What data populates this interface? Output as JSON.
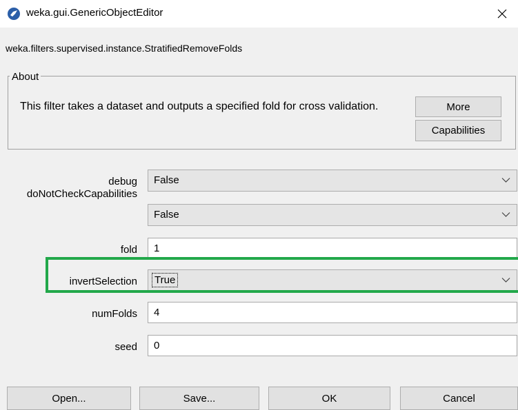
{
  "window": {
    "title": "weka.gui.GenericObjectEditor",
    "class_name": "weka.filters.supervised.instance.StratifiedRemoveFolds"
  },
  "about": {
    "legend": "About",
    "description": "This filter takes a dataset and outputs a specified fold for cross validation.",
    "more_label": "More",
    "capabilities_label": "Capabilities"
  },
  "properties": {
    "debug": {
      "label": "debug",
      "value": "False"
    },
    "doNotCheckCapabilities": {
      "label": "doNotCheckCapabilities",
      "value": "False"
    },
    "fold": {
      "label": "fold",
      "value": "1"
    },
    "invertSelection": {
      "label": "invertSelection",
      "value": "True"
    },
    "numFolds": {
      "label": "numFolds",
      "value": "4"
    },
    "seed": {
      "label": "seed",
      "value": "0"
    }
  },
  "buttons": {
    "open": "Open...",
    "save": "Save...",
    "ok": "OK",
    "cancel": "Cancel"
  },
  "colors": {
    "highlight": "#22a84a",
    "app_icon": "#2b5ea8"
  },
  "icons": {
    "app": "weka-bird-icon",
    "close": "close-icon",
    "dropdown": "chevron-down-icon"
  }
}
